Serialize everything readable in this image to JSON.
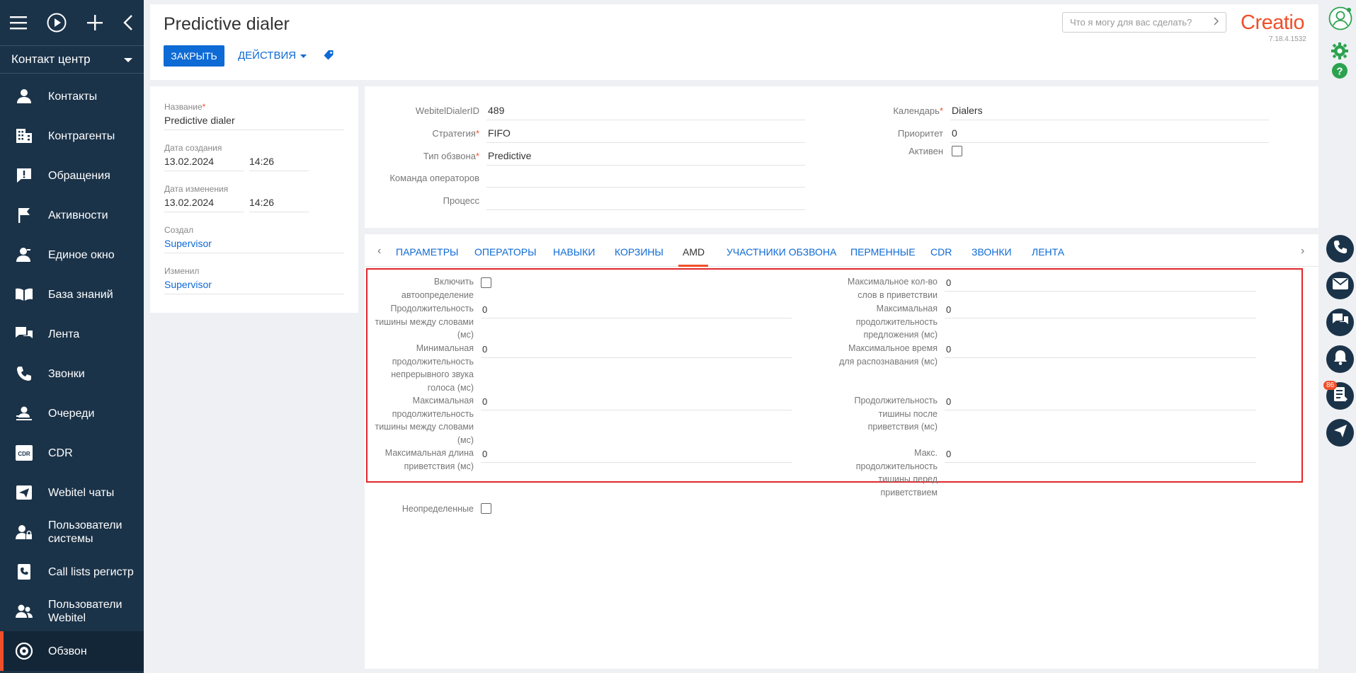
{
  "sidebar": {
    "workspace": "Контакт центр",
    "items": [
      {
        "label": "Контакты"
      },
      {
        "label": "Контрагенты"
      },
      {
        "label": "Обращения"
      },
      {
        "label": "Активности"
      },
      {
        "label": "Единое окно"
      },
      {
        "label": "База знаний"
      },
      {
        "label": "Лента"
      },
      {
        "label": "Звонки"
      },
      {
        "label": "Очереди"
      },
      {
        "label": "CDR"
      },
      {
        "label": "Webitel чаты"
      },
      {
        "label": "Пользователи системы"
      },
      {
        "label": "Call lists регистр"
      },
      {
        "label": "Пользователи Webitel"
      },
      {
        "label": "Обзвон"
      }
    ]
  },
  "header": {
    "title": "Predictive dialer",
    "close_label": "ЗАКРЫТЬ",
    "actions_label": "ДЕЙСТВИЯ",
    "search_placeholder": "Что я могу для вас сделать?",
    "logo": "Creatio",
    "version": "7.18.4.1532"
  },
  "info": {
    "name_label": "Название",
    "name_value": "Predictive dialer",
    "created_label": "Дата создания",
    "created_date": "13.02.2024",
    "created_time": "14:26",
    "modified_label": "Дата изменения",
    "modified_date": "13.02.2024",
    "modified_time": "14:26",
    "created_by_label": "Создал",
    "created_by": "Supervisor",
    "modified_by_label": "Изменил",
    "modified_by": "Supervisor"
  },
  "fields": {
    "dialer_id_label": "WebitelDialerID",
    "dialer_id": "489",
    "strategy_label": "Стратегия",
    "strategy": "FIFO",
    "call_type_label": "Тип обзвона",
    "call_type": "Predictive",
    "team_label": "Команда операторов",
    "team": "",
    "process_label": "Процесс",
    "process": "",
    "calendar_label": "Календарь",
    "calendar": "Dialers",
    "priority_label": "Приоритет",
    "priority": "0",
    "active_label": "Активен",
    "active": false
  },
  "tabs": [
    "ПАРАМЕТРЫ",
    "ОПЕРАТОРЫ",
    "НАВЫКИ",
    "КОРЗИНЫ",
    "AMD",
    "УЧАСТНИКИ ОБЗВОНА",
    "ПЕРМЕННЫЕ",
    "CDR",
    "ЗВОНКИ",
    "ЛЕНТА"
  ],
  "active_tab": "AMD",
  "amd": {
    "enable_label": "Включить автоопределение",
    "enable": false,
    "silence_between_words_label": "Продолжительность тишины между словами (мс)",
    "silence_between_words": "0",
    "min_voice_label": "Минимальная продолжительность непрерывного звука голоса (мс)",
    "min_voice": "0",
    "max_silence_between_words_label": "Максимальная продолжительность тишины между словами (мс)",
    "max_silence_between_words": "0",
    "max_greeting_label": "Максимальная длина приветствия (мс)",
    "max_greeting": "0",
    "max_words_label": "Максимальное кол-во слов в приветствии",
    "max_words": "0",
    "max_sentence_label": "Максимальная продолжительность предложения (мс)",
    "max_sentence": "0",
    "max_recognition_label": "Максимальное время для распознавания (мс)",
    "max_recognition": "0",
    "silence_after_label": "Продолжительность тишины после приветствия (мс)",
    "silence_after": "0",
    "max_silence_before_label": "Макс. продолжительность тишины перед приветствием",
    "max_silence_before": "0",
    "undefined_label": "Неопределенные",
    "undefined": false
  },
  "rail": {
    "badge_count": "86"
  },
  "colors": {
    "sidebar": "#1b3349",
    "accent": "#f04f29",
    "link": "#0e6ad5",
    "highlight_box": "#e0272a"
  }
}
